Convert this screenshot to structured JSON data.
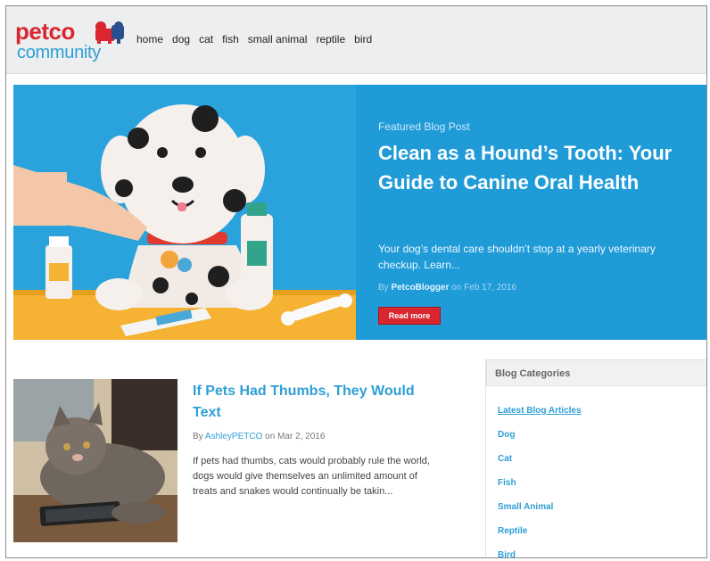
{
  "header": {
    "logo_primary": "petco",
    "logo_secondary": "community",
    "nav": [
      "home",
      "dog",
      "cat",
      "fish",
      "small animal",
      "reptile",
      "bird"
    ]
  },
  "hero": {
    "label": "Featured Blog Post",
    "title": "Clean as a Hound’s Tooth: Your Guide to Canine Oral Health",
    "excerpt": "Your dog’s dental care shouldn’t stop at a yearly veterinary checkup. Learn...",
    "meta_by": "By",
    "author": "PetcoBlogger",
    "meta_on": "on Feb 17, 2016",
    "read_more": "Read more"
  },
  "post": {
    "title": "If Pets Had Thumbs, They Would Text",
    "meta_by": "By",
    "author": "AshleyPETCO",
    "meta_on": "on Mar 2, 2016",
    "excerpt": "If pets had thumbs, cats would probably rule the world, dogs would give themselves an unlimited amount of treats and snakes would continually be takin..."
  },
  "sidebar": {
    "title": "Blog Categories",
    "categories": [
      "Latest Blog Articles",
      "Dog",
      "Cat",
      "Fish",
      "Small Animal",
      "Reptile",
      "Bird"
    ]
  },
  "colors": {
    "brand_red": "#d9262f",
    "brand_blue": "#2f9fd6",
    "hero_blue": "#1f9bd8"
  }
}
